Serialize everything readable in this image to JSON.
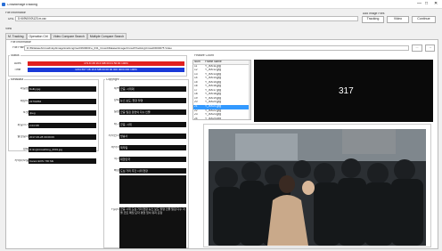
{
  "window": {
    "title": "CrowdImageTracking"
  },
  "file_info": {
    "label": "File Information",
    "url_label": "URL",
    "url_value": "D:\\6\\9\\0\\0\\0\\123.m.csv",
    "add_image_label": "Add Image Files",
    "buttons": [
      "Tracking",
      "Video",
      "Continue"
    ]
  },
  "menu": {
    "label": "View"
  },
  "tabs": [
    "M. Tracking",
    "Operation Ctrl",
    "Video Compare Search",
    "Multiple Compare Search"
  ],
  "path": {
    "label": "File Information",
    "url_label": "File Path",
    "value": "D:\\6\\Dataset\\Crowd\\Jeju\\Image\\trackmgr\\set03\\00001\\s_031_Crowd\\Dataset\\image\\Crowd\\Tracking\\Crowd\\ID00075 Video"
  },
  "status": {
    "label": "Status",
    "rows": [
      {
        "label": "Aces",
        "value": "173.8 CB 16.6 MB 00:01:50:00 100%",
        "color": "#e02020"
      },
      {
        "label": "Time",
        "value": "1234.567 CB 16.6 MB 00:00:00 000 0000.000 100%",
        "color": "#1a3ad8"
      }
    ]
  },
  "metadata": {
    "label": "Metadata",
    "fields": [
      {
        "label": "파일명",
        "value": "Dolby.jpg"
      },
      {
        "label": "해상도",
        "value": "2173x864"
      },
      {
        "label": "포맷",
        "value": "Jpeg"
      },
      {
        "label": "파일크기",
        "value": "2.04 KB"
      },
      {
        "label": "촬영일자",
        "value": "2017-06-28 09:09:06"
      },
      {
        "label": "경로",
        "value": "D:\\img\\Crowd\\img_0001.jpg"
      },
      {
        "label": "카메라모델",
        "value": "Canon EOS / 5D Mk"
      }
    ]
  },
  "copyright": {
    "label": "Copyright",
    "fields": [
      {
        "label": "제목",
        "value": "군중, 시위대"
      },
      {
        "label": "장르",
        "value": "뉴스 보도, 현장 촬영"
      },
      {
        "label": "설명",
        "value": "군중 밀집 장면의 다수 인물"
      },
      {
        "label": "태그",
        "value": "군중, 시위"
      },
      {
        "label": "저작권자",
        "value": "방송사"
      },
      {
        "label": "제작사",
        "value": "제작팀"
      },
      {
        "label": "국가",
        "value": "대한민국"
      },
      {
        "label": "배경",
        "value": "도심 거리 주간 시위 현장"
      },
      {
        "label": "키워드",
        "value": "군중 시위 도심 거리 현장 뉴스 보도 촬영 인물 밀집 다수 겨울 코트 패딩 모자 경찰 질서 유지 혼잡"
      }
    ]
  },
  "list": {
    "label": "Feature Count",
    "col_num": "Num",
    "col_name": "Frame Name",
    "rows": [
      {
        "n": "11",
        "name": "Y_00011.jpg"
      },
      {
        "n": "12",
        "name": "Y_00012.jpg"
      },
      {
        "n": "13",
        "name": "Y_00013.jpg"
      },
      {
        "n": "14",
        "name": "Y_00014.jpg"
      },
      {
        "n": "15",
        "name": "Y_00015.jpg"
      },
      {
        "n": "16",
        "name": "Y_00016.jpg"
      },
      {
        "n": "17",
        "name": "Y_00017.jpg"
      },
      {
        "n": "18",
        "name": "Y_00018.jpg"
      },
      {
        "n": "19",
        "name": "Y_00019.jpg"
      },
      {
        "n": "20",
        "name": "Y_00020.jpg"
      },
      {
        "n": "21",
        "name": "Y_00021.jpg"
      },
      {
        "n": "22",
        "name": "Y_00022.jpg"
      },
      {
        "n": "23",
        "name": "Y_00023.jpg"
      },
      {
        "n": "24",
        "name": "Y_00024.jpg"
      }
    ],
    "selected_index": 10
  },
  "preview": {
    "count": "317"
  },
  "browse_button": "...",
  "go_button": "→"
}
